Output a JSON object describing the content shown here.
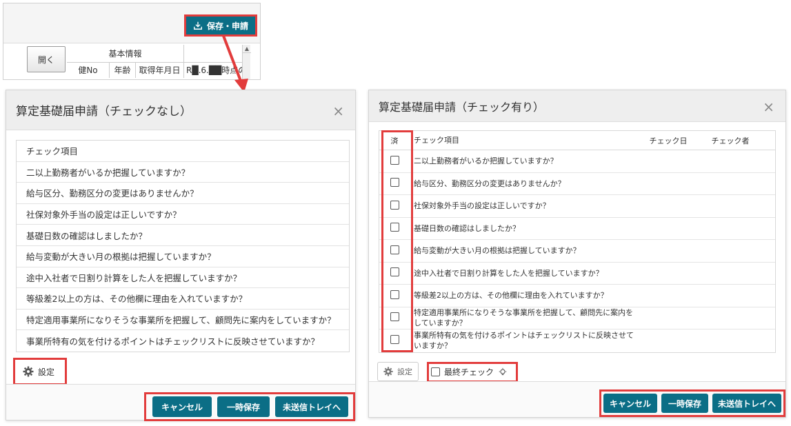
{
  "snippet": {
    "save_apply_label": "保存・申請",
    "open_label": "開く",
    "group_header": "基本情報",
    "columns": [
      "健No",
      "年齢",
      "取得年月日",
      "R█.6.██時点の"
    ]
  },
  "dialog_left": {
    "title": "算定基礎届申請（チェックなし）",
    "close_label": "×",
    "list_header": "チェック項目",
    "items": [
      "二以上勤務者がいるか把握していますか？",
      "給与区分、勤務区分の変更はありませんか？",
      "社保対象外手当の設定は正しいですか？",
      "基礎日数の確認はしましたか？",
      "給与変動が大きい月の根拠は把握していますか？",
      "途中入社者で日割り計算をした人を把握していますか？",
      "等級差2以上の方は、その他欄に理由を入れていますか？",
      "特定適用事業所になりそうな事業所を把握して、顧問先に案内をしていますか？",
      "事業所特有の気を付けるポイントはチェックリストに反映させていますか？"
    ],
    "settings_label": "設定",
    "cancel_label": "キャンセル",
    "temp_save_label": "一時保存",
    "outbox_label": "未送信トレイへ"
  },
  "dialog_right": {
    "title": "算定基礎届申請（チェック有り）",
    "close_label": "×",
    "headers": {
      "done": "済",
      "item": "チェック項目",
      "date": "チェック日",
      "user": "チェック者"
    },
    "items": [
      "二以上勤務者がいるか把握していますか？",
      "給与区分、勤務区分の変更はありませんか？",
      "社保対象外手当の設定は正しいですか？",
      "基礎日数の確認はしましたか？",
      "給与変動が大きい月の根拠は把握していますか？",
      "途中入社者で日割り計算をした人を把握していますか？",
      "等級差2以上の方は、その他欄に理由を入れていますか？",
      "特定適用事業所になりそうな事業所を把握して、顧問先に案内をしていますか？",
      "事業所特有の気を付けるポイントはチェックリストに反映させていますか？"
    ],
    "settings_label": "設定",
    "final_check_label": "最終チェック",
    "cancel_label": "キャンセル",
    "temp_save_label": "一時保存",
    "outbox_label": "未送信トレイへ"
  },
  "colors": {
    "accent": "#0b6e86",
    "highlight": "#e23c3c"
  },
  "icons": [
    "download-icon",
    "gear-icon",
    "lightbulb-icon",
    "close-icon",
    "arrow-icon"
  ]
}
